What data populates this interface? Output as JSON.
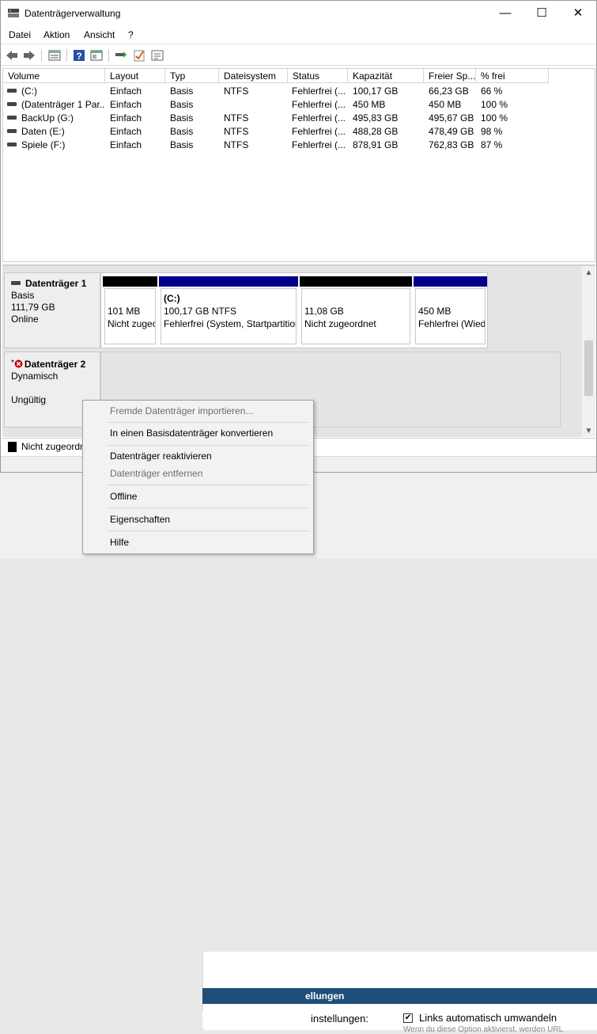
{
  "bg_window": {
    "header_suffix": "ellungen",
    "setting_label": "instellungen:",
    "checkbox_label": "Links automatisch umwandeln",
    "checkbox_mark": "✔",
    "sub_text": "Wenn du diese Option aktivierst, werden URL"
  },
  "window": {
    "title": "Datenträgerverwaltung",
    "controls": {
      "minimize": "—",
      "maximize": "☐",
      "close": "✕"
    }
  },
  "menu": [
    "Datei",
    "Aktion",
    "Ansicht",
    "?"
  ],
  "toolbar": {
    "buttons": [
      "back-icon",
      "forward-icon",
      "list-view-icon",
      "help-icon",
      "properties-icon",
      "connect-icon",
      "check-icon",
      "settings-list-icon"
    ],
    "help_glyph": "?"
  },
  "volume_list": {
    "columns": [
      "Volume",
      "Layout",
      "Typ",
      "Dateisystem",
      "Status",
      "Kapazität",
      "Freier Sp...",
      "% frei"
    ],
    "rows": [
      {
        "volume": "(C:)",
        "layout": "Einfach",
        "typ": "Basis",
        "fs": "NTFS",
        "status": "Fehlerfrei (...",
        "kapazitaet": "100,17 GB",
        "frei": "66,23 GB",
        "prozent": "66 %"
      },
      {
        "volume": "(Datenträger 1 Par...",
        "layout": "Einfach",
        "typ": "Basis",
        "fs": "",
        "status": "Fehlerfrei (...",
        "kapazitaet": "450 MB",
        "frei": "450 MB",
        "prozent": "100 %"
      },
      {
        "volume": "BackUp (G:)",
        "layout": "Einfach",
        "typ": "Basis",
        "fs": "NTFS",
        "status": "Fehlerfrei (...",
        "kapazitaet": "495,83 GB",
        "frei": "495,67 GB",
        "prozent": "100 %"
      },
      {
        "volume": "Daten (E:)",
        "layout": "Einfach",
        "typ": "Basis",
        "fs": "NTFS",
        "status": "Fehlerfrei (...",
        "kapazitaet": "488,28 GB",
        "frei": "478,49 GB",
        "prozent": "98 %"
      },
      {
        "volume": "Spiele (F:)",
        "layout": "Einfach",
        "typ": "Basis",
        "fs": "NTFS",
        "status": "Fehlerfrei (...",
        "kapazitaet": "878,91 GB",
        "frei": "762,83 GB",
        "prozent": "87 %"
      }
    ]
  },
  "disks": [
    {
      "name": "Datenträger 1",
      "type": "Basis",
      "size": "111,79 GB",
      "state": "Online",
      "partitions": [
        {
          "bar_color": "#000000",
          "line1": "101 MB",
          "line2": "Nicht zugeordnet",
          "title": ""
        },
        {
          "bar_color": "#00008b",
          "title": "(C:)",
          "line1": "100,17 GB NTFS",
          "line2": "Fehlerfrei (System, Startpartition"
        },
        {
          "bar_color": "#000000",
          "line1": "11,08 GB",
          "line2": "Nicht zugeordnet",
          "title": ""
        },
        {
          "bar_color": "#00008b",
          "line1": "450 MB",
          "line2": "Fehlerfrei (Wiederherstellung",
          "title": ""
        }
      ]
    },
    {
      "name": "Datenträger 2",
      "type": "Dynamisch",
      "state": "Ungültig",
      "status_mark": "*"
    }
  ],
  "legend": {
    "label": "Nicht zugeordnet"
  },
  "context_menu": {
    "items": [
      {
        "label": "Fremde Datenträger importieren...",
        "enabled": false
      },
      {
        "label": "In einen Basisdatenträger konvertieren",
        "enabled": true
      },
      {
        "label": "Datenträger reaktivieren",
        "enabled": true
      },
      {
        "label": "Datenträger entfernen",
        "enabled": false
      },
      {
        "label": "Offline",
        "enabled": true
      },
      {
        "label": "Eigenschaften",
        "enabled": true
      },
      {
        "label": "Hilfe",
        "enabled": true
      }
    ]
  },
  "colors": {
    "primary_partition": "#00008b",
    "unallocated": "#000000",
    "error": "#cc0000"
  }
}
